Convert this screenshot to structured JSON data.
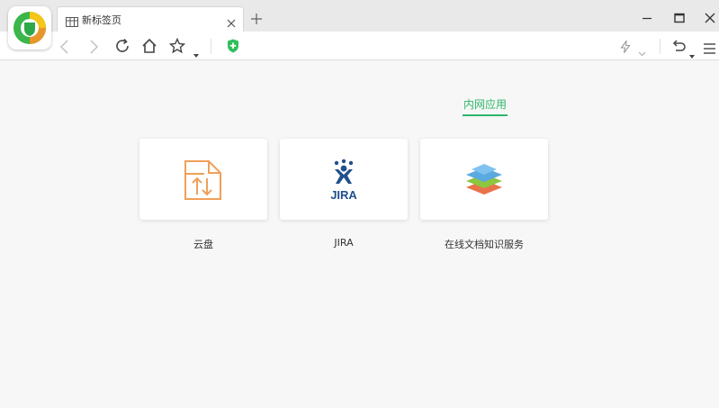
{
  "tabs": [
    {
      "title": "新标签页",
      "icon": "grid-icon"
    }
  ],
  "section": {
    "tab_label": "内网应用",
    "accent_color": "#2fb66b"
  },
  "apps": [
    {
      "name": "云盘",
      "icon": "cloud-drive-icon",
      "icon_color": "#f0a05a"
    },
    {
      "name": "JIRA",
      "icon": "jira-icon",
      "icon_text": "JIRA",
      "icon_color": "#1f4f8c"
    },
    {
      "name": "在线文档知识服务",
      "icon": "layers-icon"
    }
  ],
  "colors": {
    "background": "#f7f7f7",
    "titlebar": "#e9e9e9",
    "shield": "#2fbf5e"
  }
}
